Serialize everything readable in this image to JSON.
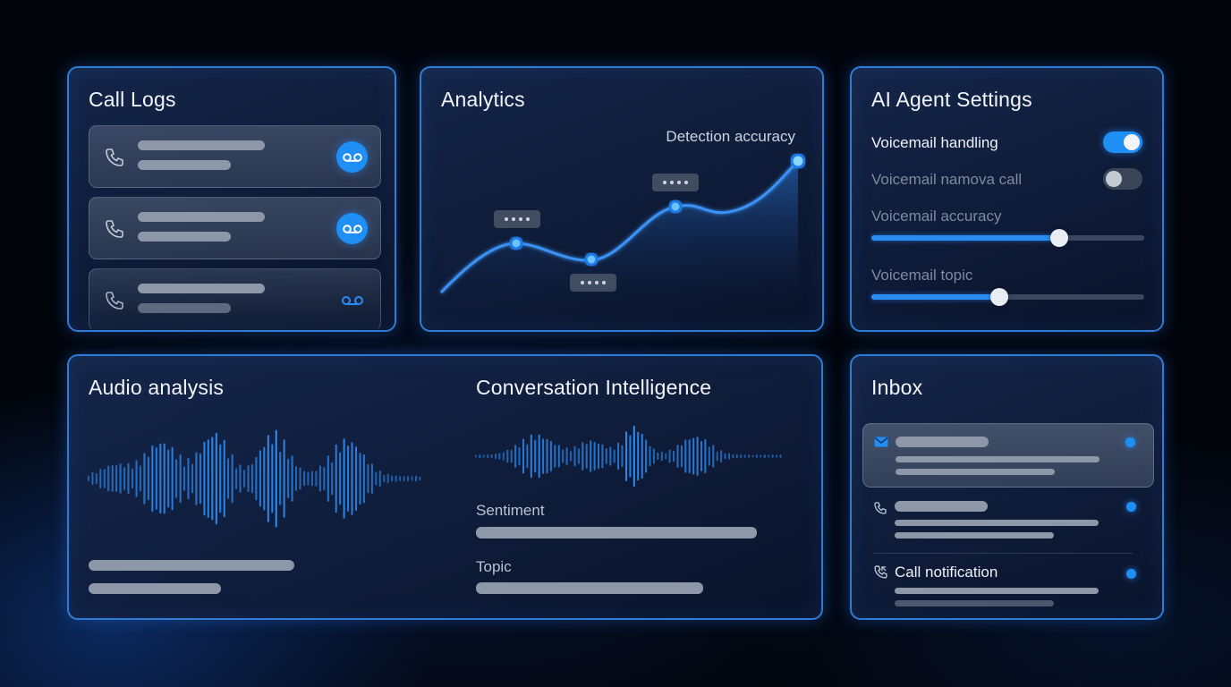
{
  "call_logs": {
    "title": "Call Logs",
    "items": [
      {
        "icon": "phone-icon",
        "badge_icon": "voicemail-icon"
      },
      {
        "icon": "phone-icon",
        "badge_icon": "voicemail-icon"
      },
      {
        "icon": "phone-icon",
        "badge_icon": "voicemail-icon"
      }
    ]
  },
  "analytics": {
    "title": "Analytics",
    "caption": "Detection accuracy"
  },
  "settings": {
    "title": "AI Agent Settings",
    "voicemail_handling": {
      "label": "Voicemail handling",
      "on": true
    },
    "voicemail_call": {
      "label": "Voicemail namova call",
      "on": false
    },
    "accuracy": {
      "label": "Voicemail accuracy",
      "value": 0.69
    },
    "topic": {
      "label": "Voicemail topic",
      "value": 0.47
    }
  },
  "audio": {
    "title": "Audio analysis"
  },
  "conversation": {
    "title": "Conversation Intelligence",
    "sentiment_label": "Sentiment",
    "topic_label": "Topic"
  },
  "inbox": {
    "title": "Inbox",
    "items": [
      {
        "icon": "mail-icon",
        "unread": true
      },
      {
        "icon": "phone-icon",
        "unread": true
      },
      {
        "icon": "incoming-call-icon",
        "label": "Call notification",
        "unread": true
      }
    ]
  },
  "colors": {
    "accent": "#1f8ef5",
    "panel_border": "#2f7cd6",
    "background": "#02050c"
  }
}
